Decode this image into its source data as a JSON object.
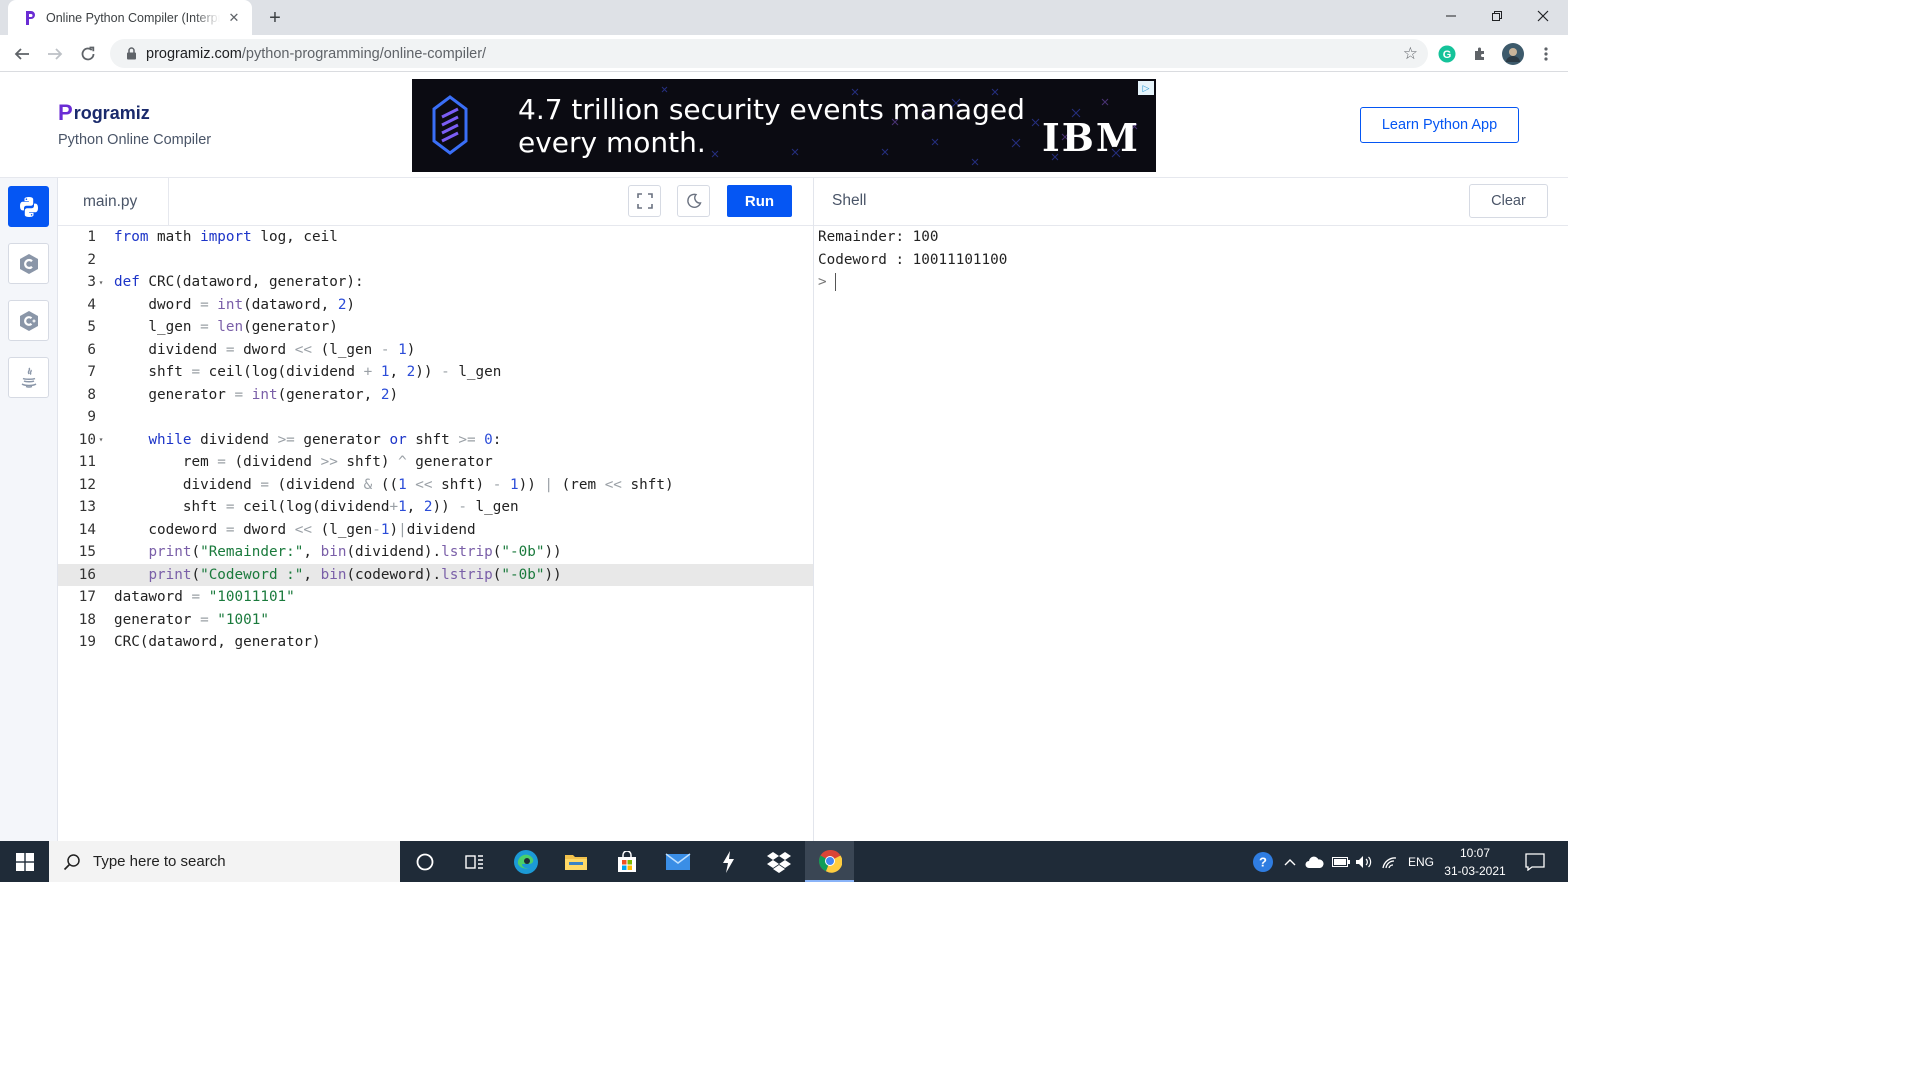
{
  "browser": {
    "tab_title": "Online Python Compiler (Interpreter) - Programiz",
    "url_host": "programiz.com",
    "url_path": "/python-programming/online-compiler/"
  },
  "site": {
    "logo_text": "rogramiz",
    "logo_letter": "P",
    "subtitle": "Python Online Compiler",
    "learn_button": "Learn Python App"
  },
  "ad": {
    "text_line1": "4.7 trillion security events managed",
    "text_line2": "every month.",
    "brand": "IBM"
  },
  "editor": {
    "file_tab": "main.py",
    "run_label": "Run",
    "current_line": 16,
    "line_numbers": [
      "1",
      "2",
      "3",
      "4",
      "5",
      "6",
      "7",
      "8",
      "9",
      "10",
      "11",
      "12",
      "13",
      "14",
      "15",
      "16",
      "17",
      "18",
      "19"
    ],
    "code_lines": [
      "from math import log, ceil",
      "",
      "def CRC(dataword, generator):",
      "    dword = int(dataword, 2)",
      "    l_gen = len(generator)",
      "    dividend = dword << (l_gen - 1)",
      "    shft = ceil(log(dividend + 1, 2)) - l_gen",
      "    generator = int(generator, 2)",
      "",
      "    while dividend >= generator or shft >= 0:",
      "        rem = (dividend >> shft) ^ generator",
      "        dividend = (dividend & ((1 << shft) - 1)) | (rem << shft)",
      "        shft = ceil(log(dividend+1, 2)) - l_gen",
      "    codeword = dword << (l_gen-1)|dividend",
      "    print(\"Remainder:\", bin(dividend).lstrip(\"-0b\"))",
      "    print(\"Codeword :\", bin(codeword).lstrip(\"-0b\"))",
      "dataword = \"10011101\"",
      "generator = \"1001\"",
      "CRC(dataword, generator)"
    ]
  },
  "shell": {
    "title": "Shell",
    "clear_label": "Clear",
    "output": [
      "Remainder: 100",
      "Codeword : 10011101100"
    ],
    "prompt": ">"
  },
  "taskbar": {
    "search_placeholder": "Type here to search",
    "language": "ENG",
    "time": "10:07",
    "date": "31-03-2021"
  },
  "colors": {
    "accent": "#0556f3",
    "keyword": "#1c34c8",
    "string": "#1a7a3c",
    "taskbar": "#1f2b38"
  }
}
